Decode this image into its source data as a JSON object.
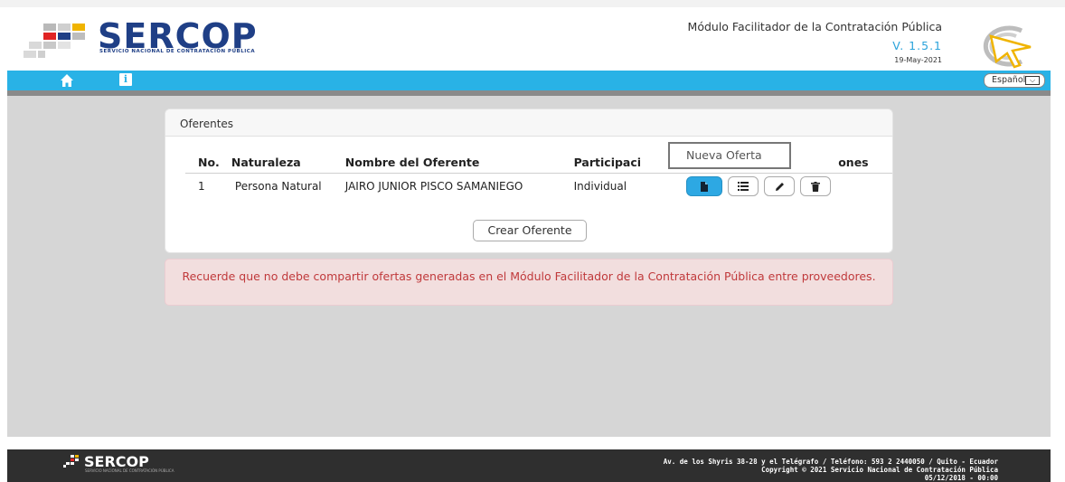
{
  "header": {
    "logo_text": "SERCOP",
    "logo_subtitle": "SERVICIO NACIONAL DE CONTRATACIÓN PÚBLICA",
    "title": "Módulo Facilitador de la Contratación Pública",
    "version": "V. 1.5.1",
    "date": "19-May-2021"
  },
  "nav": {
    "home_icon": "home-icon",
    "info_icon": "info-icon",
    "info_glyph": "i",
    "language": "Español"
  },
  "panel": {
    "title": "Oferentes",
    "columns": [
      "No.",
      "Naturaleza",
      "Nombre del Oferente",
      "Participaci",
      "ones"
    ],
    "rows": [
      {
        "no": "1",
        "naturaleza": "Persona Natural",
        "nombre": "JAIRO JUNIOR PISCO SAMANIEGO",
        "participacion": "Individual"
      }
    ],
    "actions": [
      {
        "icon": "document-icon",
        "tooltip": "Nueva Oferta"
      },
      {
        "icon": "list-icon"
      },
      {
        "icon": "pencil-icon"
      },
      {
        "icon": "trash-icon"
      }
    ],
    "tooltip": "Nueva Oferta",
    "create_button": "Crear Oferente"
  },
  "alert": {
    "message": "Recuerde que no debe compartir ofertas generadas en el Módulo Facilitador de la Contratación Pública entre proveedores."
  },
  "footer": {
    "logo_text": "SERCOP",
    "logo_subtitle": "SERVICIO NACIONAL DE CONTRATACIÓN PÚBLICA",
    "address": "Av. de los Shyris 38-28 y el Telégrafo / Teléfono: 593 2 2440050 / Quito - Ecuador",
    "copyright": "Copyright © 2021 Servicio Nacional de Contratación Pública",
    "build": "05/12/2018 - 00:00"
  },
  "colors": {
    "nav_blue": "#29b2e6",
    "brand_navy": "#1f3f86",
    "alert_bg": "#f2dede",
    "alert_text": "#c0393b",
    "primary_button": "#2da8e3"
  }
}
